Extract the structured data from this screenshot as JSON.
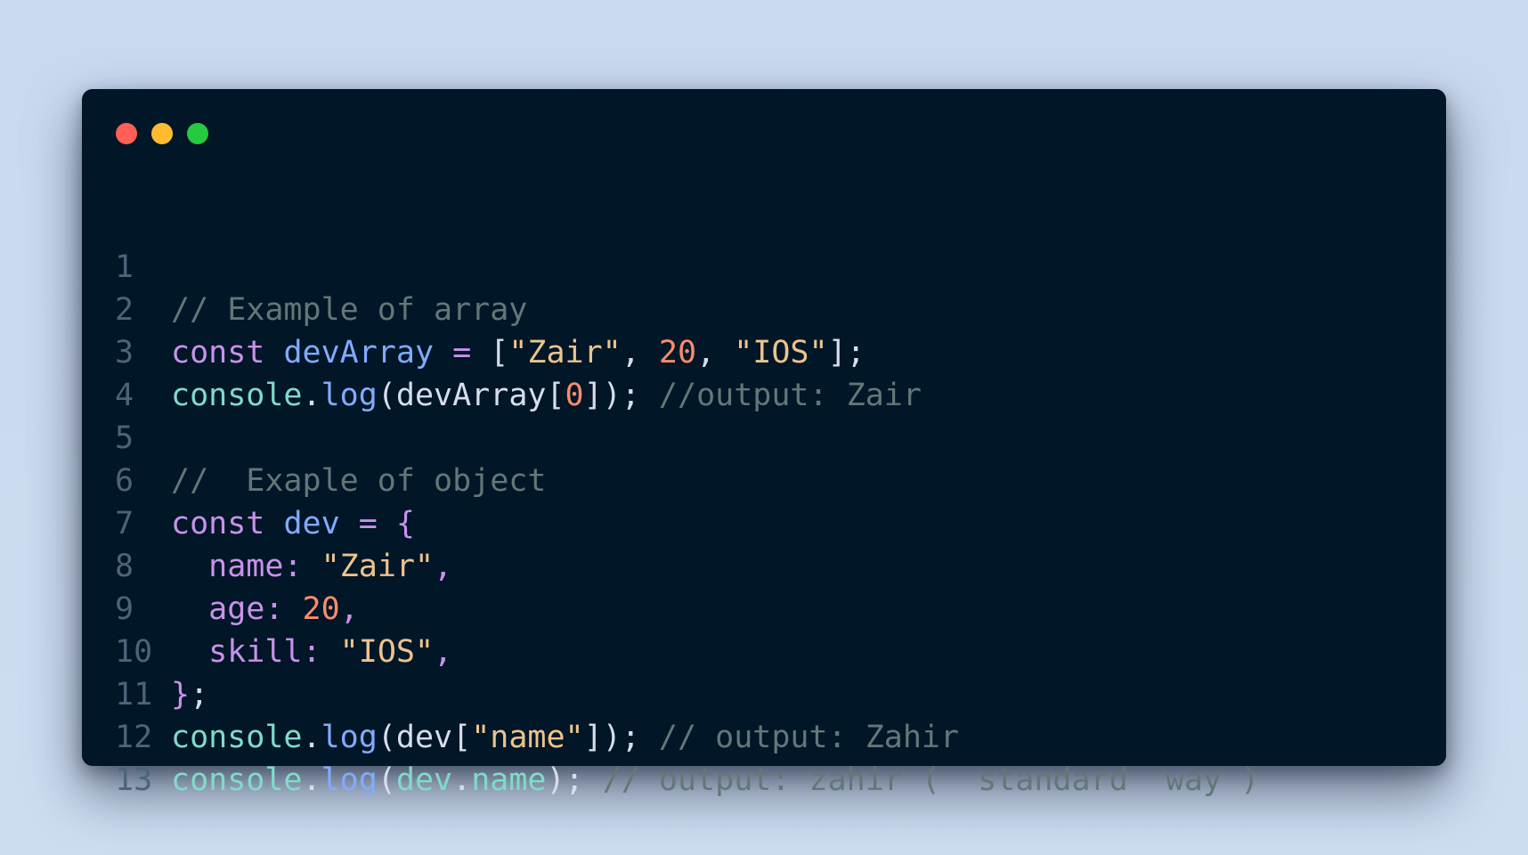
{
  "window": {
    "controls": [
      {
        "name": "close",
        "color": "#ff5f56"
      },
      {
        "name": "minimize",
        "color": "#ffbd2e"
      },
      {
        "name": "maximize",
        "color": "#27c93f"
      }
    ]
  },
  "editor": {
    "lines": [
      {
        "number": "1",
        "tokens": []
      },
      {
        "number": "2",
        "tokens": [
          {
            "t": "comment",
            "text": "// Example of array"
          }
        ]
      },
      {
        "number": "3",
        "tokens": [
          {
            "t": "keyword",
            "text": "const "
          },
          {
            "t": "var",
            "text": "devArray"
          },
          {
            "t": "op",
            "text": " = "
          },
          {
            "t": "punc",
            "text": "["
          },
          {
            "t": "string",
            "text": "\"Zair\""
          },
          {
            "t": "punc",
            "text": ", "
          },
          {
            "t": "number",
            "text": "20"
          },
          {
            "t": "punc",
            "text": ", "
          },
          {
            "t": "string",
            "text": "\"IOS\""
          },
          {
            "t": "punc",
            "text": "];"
          }
        ]
      },
      {
        "number": "4",
        "tokens": [
          {
            "t": "console",
            "text": "console"
          },
          {
            "t": "punc",
            "text": "."
          },
          {
            "t": "func",
            "text": "log"
          },
          {
            "t": "punc",
            "text": "("
          },
          {
            "t": "plain",
            "text": "devArray"
          },
          {
            "t": "punc",
            "text": "["
          },
          {
            "t": "number",
            "text": "0"
          },
          {
            "t": "punc",
            "text": "]); "
          },
          {
            "t": "comment",
            "text": "//output: Zair"
          }
        ]
      },
      {
        "number": "5",
        "tokens": []
      },
      {
        "number": "6",
        "tokens": [
          {
            "t": "comment",
            "text": "//  Exaple of object"
          }
        ]
      },
      {
        "number": "7",
        "tokens": [
          {
            "t": "keyword",
            "text": "const "
          },
          {
            "t": "var",
            "text": "dev"
          },
          {
            "t": "op",
            "text": " = "
          },
          {
            "t": "brace",
            "text": "{"
          }
        ]
      },
      {
        "number": "8",
        "tokens": [
          {
            "t": "plain",
            "text": "  "
          },
          {
            "t": "prop",
            "text": "name"
          },
          {
            "t": "prop",
            "text": ": "
          },
          {
            "t": "string",
            "text": "\"Zair\""
          },
          {
            "t": "prop",
            "text": ","
          }
        ]
      },
      {
        "number": "9",
        "tokens": [
          {
            "t": "plain",
            "text": "  "
          },
          {
            "t": "prop",
            "text": "age"
          },
          {
            "t": "prop",
            "text": ": "
          },
          {
            "t": "number",
            "text": "20"
          },
          {
            "t": "prop",
            "text": ","
          }
        ]
      },
      {
        "number": "10",
        "tokens": [
          {
            "t": "plain",
            "text": "  "
          },
          {
            "t": "prop",
            "text": "skill"
          },
          {
            "t": "prop",
            "text": ": "
          },
          {
            "t": "string",
            "text": "\"IOS\""
          },
          {
            "t": "prop",
            "text": ","
          }
        ]
      },
      {
        "number": "11",
        "tokens": [
          {
            "t": "brace",
            "text": "}"
          },
          {
            "t": "punc",
            "text": ";"
          }
        ]
      },
      {
        "number": "12",
        "tokens": [
          {
            "t": "console",
            "text": "console"
          },
          {
            "t": "punc",
            "text": "."
          },
          {
            "t": "func",
            "text": "log"
          },
          {
            "t": "punc",
            "text": "("
          },
          {
            "t": "plain",
            "text": "dev"
          },
          {
            "t": "punc",
            "text": "["
          },
          {
            "t": "string",
            "text": "\"name\""
          },
          {
            "t": "punc",
            "text": "]); "
          },
          {
            "t": "comment",
            "text": "// output: Zahir"
          }
        ]
      },
      {
        "number": "13",
        "tokens": [
          {
            "t": "console",
            "text": "console"
          },
          {
            "t": "punc",
            "text": "."
          },
          {
            "t": "func",
            "text": "log"
          },
          {
            "t": "punc",
            "text": "("
          },
          {
            "t": "console",
            "text": "dev"
          },
          {
            "t": "punc",
            "text": "."
          },
          {
            "t": "console",
            "text": "name"
          },
          {
            "t": "punc",
            "text": "); "
          },
          {
            "t": "comment",
            "text": "// output: zahir (  standard  way )"
          }
        ]
      }
    ]
  }
}
